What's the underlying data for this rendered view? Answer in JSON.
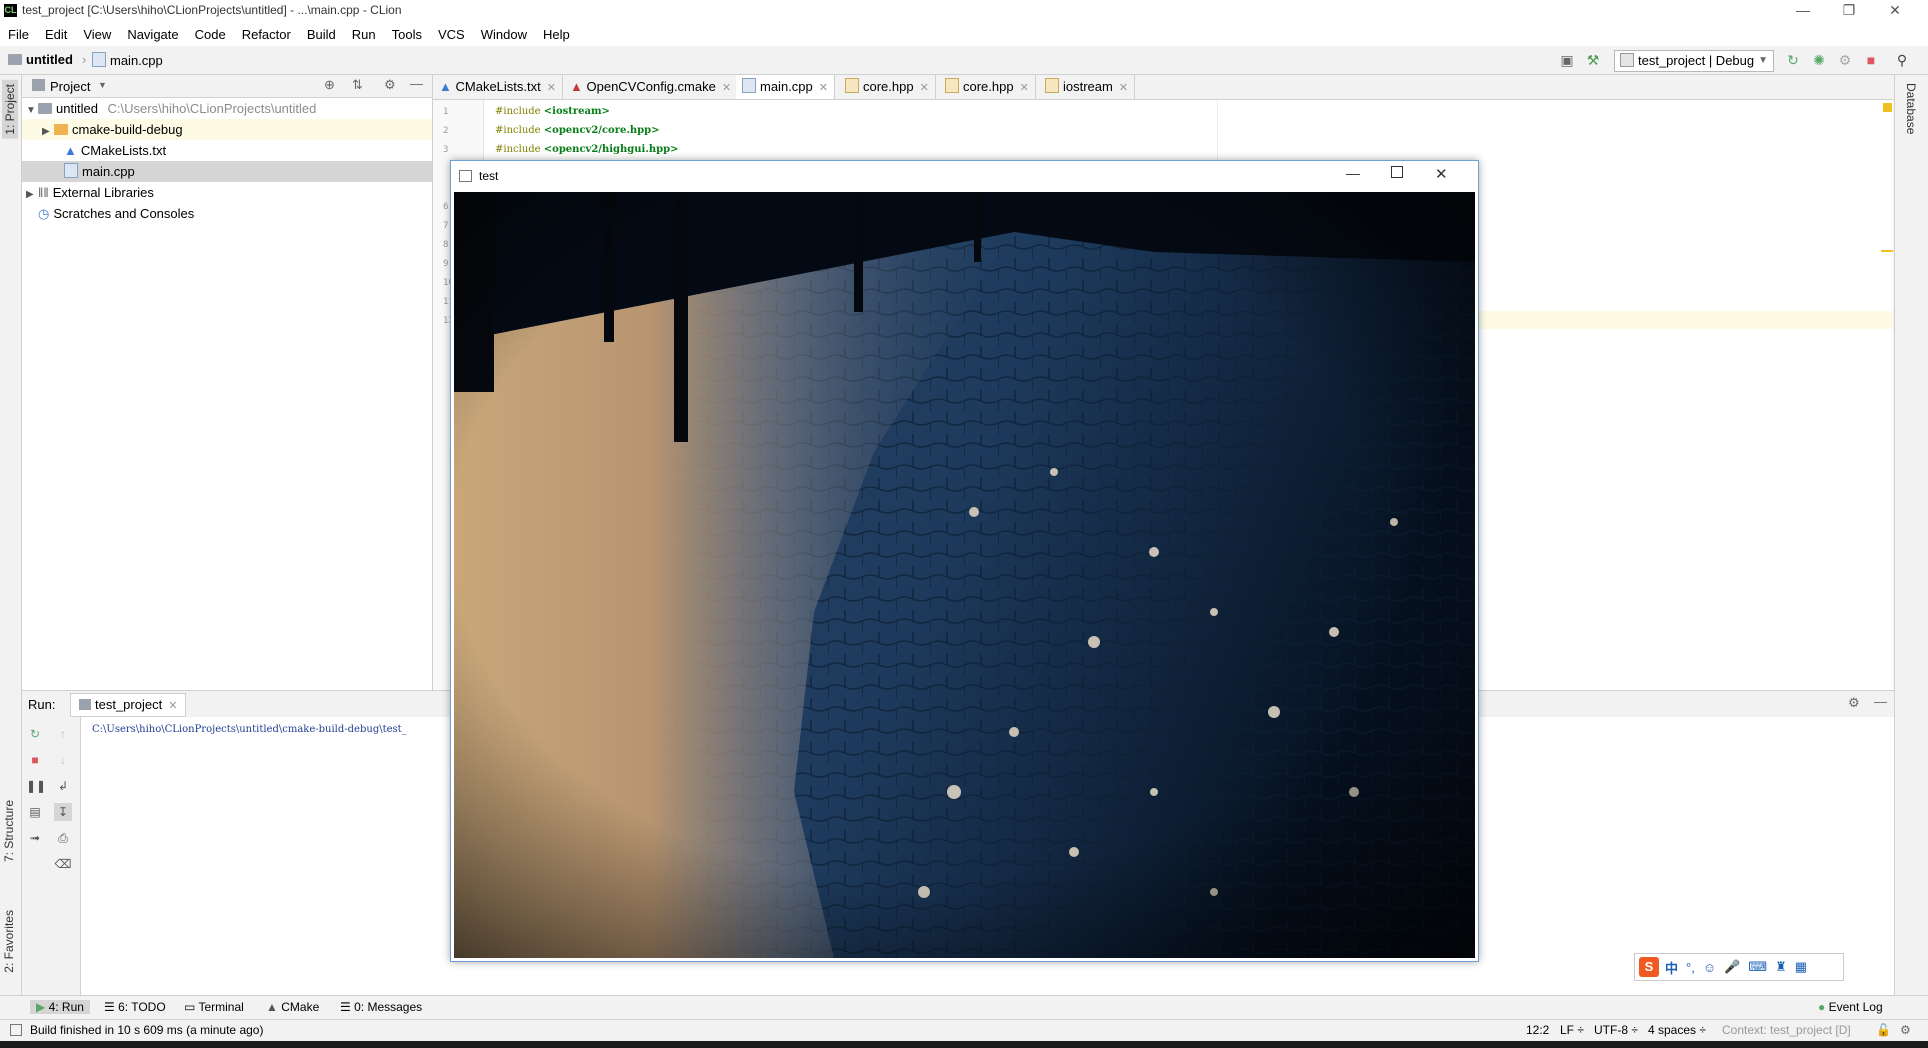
{
  "window": {
    "title": "test_project [C:\\Users\\hiho\\CLionProjects\\untitled] - ...\\main.cpp - CLion",
    "app_icon": "CL"
  },
  "menu": [
    "File",
    "Edit",
    "View",
    "Navigate",
    "Code",
    "Refactor",
    "Build",
    "Run",
    "Tools",
    "VCS",
    "Window",
    "Help"
  ],
  "breadcrumb": {
    "project": "untitled",
    "file": "main.cpp"
  },
  "toolbar": {
    "run_config": "test_project | Debug"
  },
  "left_stripe": {
    "project_tab": "1: Project",
    "structure_tab": "7: Structure",
    "favorites_tab": "2: Favorites"
  },
  "right_stripe": {
    "database_tab": "Database"
  },
  "project_panel": {
    "title": "Project",
    "root": {
      "name": "untitled",
      "path": "C:\\Users\\hiho\\CLionProjects\\untitled"
    },
    "items": [
      {
        "name": "cmake-build-debug"
      },
      {
        "name": "CMakeLists.txt"
      },
      {
        "name": "main.cpp"
      }
    ],
    "external": "External Libraries",
    "scratches": "Scratches and Consoles"
  },
  "editor": {
    "tabs": [
      "CMakeLists.txt",
      "OpenCVConfig.cmake",
      "main.cpp",
      "core.hpp",
      "core.hpp",
      "iostream"
    ],
    "active_tab": 2,
    "lines": [
      {
        "n": "1",
        "kw": "#include ",
        "inc": "<iostream>"
      },
      {
        "n": "2",
        "kw": "#include ",
        "inc": "<opencv2/core.hpp>"
      },
      {
        "n": "3",
        "kw": "#include ",
        "inc": "<opencv2/highgui.hpp>"
      }
    ],
    "hidden_line_numbers": [
      "6",
      "7",
      "8",
      "9",
      "10",
      "11",
      "12"
    ]
  },
  "run_panel": {
    "label": "Run:",
    "tab": "test_project",
    "output": "C:\\Users\\hiho\\CLionProjects\\untitled\\cmake-build-debug\\test_"
  },
  "tool_tabs": [
    "4: Run",
    "6: TODO",
    "Terminal",
    "CMake",
    "0: Messages"
  ],
  "event_log": "Event Log",
  "status": {
    "message": "Build finished in 10 s 609 ms (a minute ago)",
    "position": "12:2",
    "line_sep": "LF ÷",
    "encoding": "UTF-8 ÷",
    "indent": "4 spaces ÷",
    "context": "Context: test_project [D]"
  },
  "popup": {
    "title": "test"
  },
  "ime": {
    "lang": "中"
  },
  "colors": {
    "accent": "#6e9fd6",
    "run_green": "#59a869",
    "stop_red": "#db5860"
  }
}
